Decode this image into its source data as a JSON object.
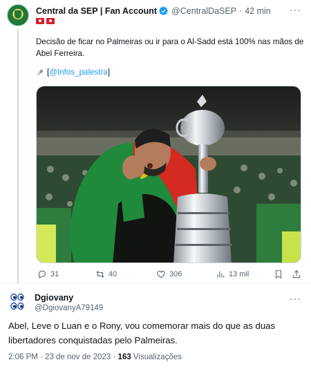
{
  "tweet": {
    "author_name": "Central da SEP | Fan Account",
    "handle": "@CentralDaSEP",
    "separator": "·",
    "time": "42 min",
    "body": "Decisão de ficar no Palmeiras ou ir para o Al-Sadd está 100% nas mãos de Abel Ferreira.",
    "source_open": "[",
    "source_link": "@Infos_palestra",
    "source_close": "]",
    "stats": {
      "replies": "31",
      "retweets": "40",
      "likes": "306",
      "views": "13 mil"
    }
  },
  "reply": {
    "author_name": "Dgiovany",
    "handle": "@DgiovanyA79149",
    "body": "Abel, Leve o Luan e o Rony,  vou comemorar mais do que as duas libertadores conquistadas pelo Palmeiras.",
    "timestamp": "2:06 PM · 23 de nov de 2023 · ",
    "views_count": "163",
    "views_label": " Visualizações"
  },
  "colors": {
    "accent": "#1d9bf0",
    "text": "#0f1419",
    "secondary": "#536471",
    "palmeiras_green": "#1f7a3a",
    "flag_red": "#d81e2c"
  },
  "icons": {
    "reply": "reply-icon",
    "retweet": "retweet-icon",
    "like": "heart-icon",
    "views": "views-chart-icon",
    "bookmark": "bookmark-icon",
    "share": "share-icon",
    "more": "more-icon",
    "verified": "verified-badge-icon"
  }
}
